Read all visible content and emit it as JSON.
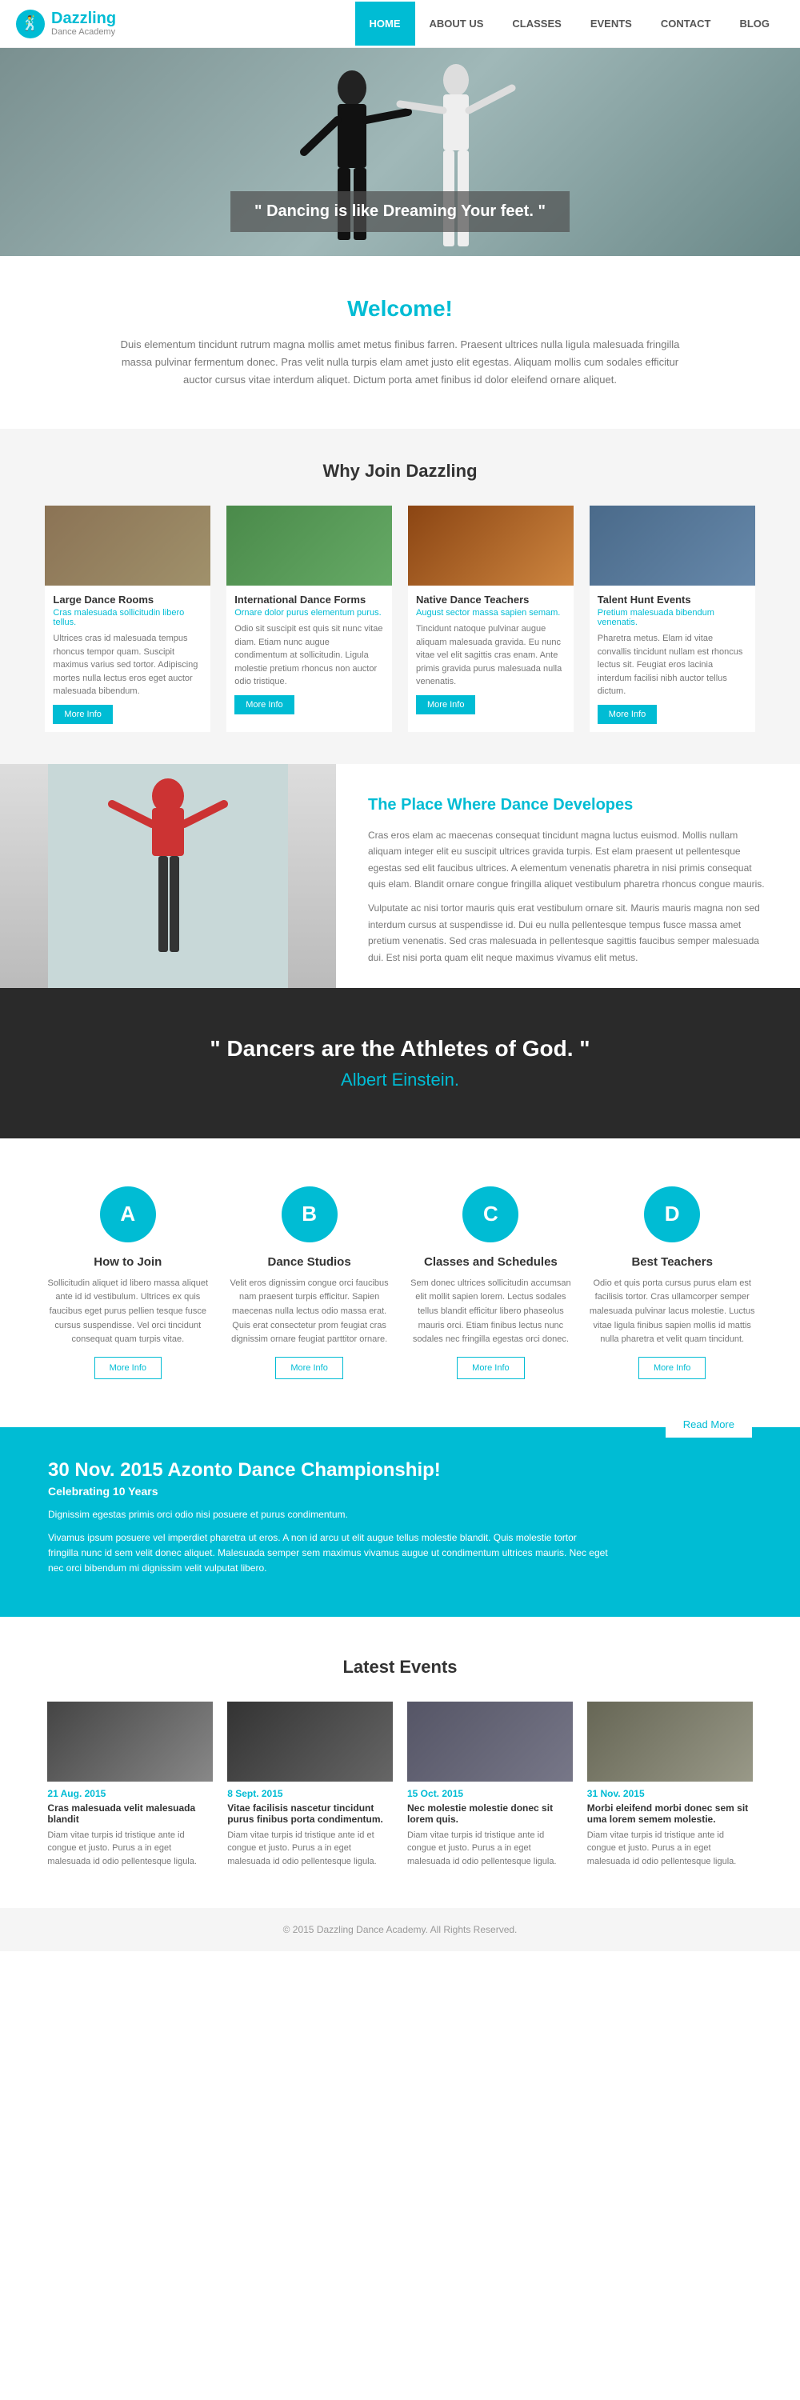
{
  "nav": {
    "logo_brand": "Dazzling",
    "logo_sub": "Dance Academy",
    "links": [
      {
        "label": "HOME",
        "active": true,
        "id": "home"
      },
      {
        "label": "ABOUT US",
        "active": false,
        "id": "about"
      },
      {
        "label": "CLASSES",
        "active": false,
        "id": "classes"
      },
      {
        "label": "EVENTS",
        "active": false,
        "id": "events"
      },
      {
        "label": "CONTACT",
        "active": false,
        "id": "contact"
      },
      {
        "label": "BLOG",
        "active": false,
        "id": "blog"
      }
    ]
  },
  "hero": {
    "quote": "\" Dancing is like Dreaming Your feet. \""
  },
  "welcome": {
    "heading": "Welcome!",
    "body": "Duis elementum tincidunt rutrum magna mollis amet metus finibus farren. Praesent ultrices nulla ligula malesuada fringilla massa pulvinar fermentum donec. Pras velit nulla turpis elam amet justo elit egestas. Aliquam mollis cum sodales efficitur auctor cursus vitae interdum aliquet. Dictum porta amet finibus id dolor eleifend ornare aliquet."
  },
  "why_join": {
    "heading": "Why Join Dazzling",
    "cards": [
      {
        "title": "Large Dance Rooms",
        "subtitle": "Cras malesuada sollicitudin libero tellus.",
        "desc": "Ultrices cras id malesuada tempus rhoncus tempor quam. Suscipit maximus varius sed tortor. Adipiscing mortes nulla lectus eros eget auctor malesuada bibendum.",
        "btn": "More Info"
      },
      {
        "title": "International Dance Forms",
        "subtitle": "Ornare dolor purus elementum purus.",
        "desc": "Odio sit suscipit est quis sit nunc vitae diam. Etiam nunc augue condimentum at sollicitudin. Ligula molestie pretium rhoncus non auctor odio tristique.",
        "btn": "More Info"
      },
      {
        "title": "Native Dance Teachers",
        "subtitle": "August sector massa sapien semam.",
        "desc": "Tincidunt natoque pulvinar augue aliquam malesuada gravida. Eu nunc vitae vel elit sagittis cras enam. Ante primis gravida purus malesuada nulla venenatis.",
        "btn": "More Info"
      },
      {
        "title": "Talent Hunt Events",
        "subtitle": "Pretium malesuada bibendum venenatis.",
        "desc": "Pharetra metus. Elam id vitae convallis tincidunt nullam est rhoncus lectus sit. Feugiat eros lacinia interdum facilisi nibh auctor tellus dictum.",
        "btn": "More Info"
      }
    ]
  },
  "place": {
    "heading": "The Place Where Dance Developes",
    "para1": "Cras eros elam ac maecenas consequat tincidunt magna luctus euismod. Mollis nullam aliquam integer elit eu suscipit ultrices gravida turpis. Est elam praesent ut pellentesque egestas sed elit faucibus ultrices. A elementum venenatis pharetra in nisi primis consequat quis elam. Blandit ornare congue fringilla aliquet vestibulum pharetra rhoncus congue mauris.",
    "para2": "Vulputate ac nisi tortor mauris quis erat vestibulum ornare sit. Mauris mauris magna non sed interdum cursus at suspendisse id. Dui eu nulla pellentesque tempus fusce massa amet pretium venenatis. Sed cras malesuada in pellentesque sagittis faucibus semper malesuada dui. Est nisi porta quam elit neque maximus vivamus elit metus."
  },
  "quote": {
    "main": "\" Dancers are the Athletes of God. \"",
    "attribution": "Albert Einstein."
  },
  "features": {
    "items": [
      {
        "icon": "A",
        "title": "How to Join",
        "desc": "Sollicitudin aliquet id libero massa aliquet ante id id vestibulum. Ultrices ex quis faucibus eget purus pellien tesque fusce cursus suspendisse. Vel orci tincidunt consequat quam turpis vitae.",
        "btn": "More Info"
      },
      {
        "icon": "B",
        "title": "Dance Studios",
        "desc": "Velit eros dignissim congue orci faucibus nam praesent turpis efficitur. Sapien maecenas nulla lectus odio massa erat. Quis erat consectetur prom feugiat cras dignissim ornare feugiat parttitor ornare.",
        "btn": "More Info"
      },
      {
        "icon": "C",
        "title": "Classes and Schedules",
        "desc": "Sem donec ultrices sollicitudin accumsan elit mollit sapien lorem. Lectus sodales tellus blandit efficitur libero phaseolus mauris orci. Etiam finibus lectus nunc sodales nec fringilla egestas orci donec.",
        "btn": "More Info"
      },
      {
        "icon": "D",
        "title": "Best Teachers",
        "desc": "Odio et quis porta cursus purus elam est facilisis tortor. Cras ullamcorper semper malesuada pulvinar lacus molestie. Luctus vitae ligula finibus sapien mollis id mattis nulla pharetra et velit quam tincidunt.",
        "btn": "More Info"
      }
    ]
  },
  "banner": {
    "heading": "30 Nov. 2015 Azonto Dance Championship!",
    "subheading": "Celebrating 10 Years",
    "desc1": "Dignissim egestas primis orci odio nisi posuere et purus condimentum.",
    "desc2": "Vivamus ipsum posuere vel imperdiet pharetra ut eros. A non id arcu ut elit augue tellus molestie blandit. Quis molestie tortor fringilla nunc id sem velit donec aliquet. Malesuada semper sem maximus vivamus augue ut condimentum ultrices mauris. Nec eget nec orci bibendum mi dignissim velit vulputat libero.",
    "btn": "Read More"
  },
  "latest_events": {
    "heading": "Latest Events",
    "events": [
      {
        "date": "21 Aug. 2015",
        "title": "Cras malesuada velit malesuada blandit",
        "desc": "Diam vitae turpis id tristique ante id congue et justo. Purus a in eget malesuada id odio pellentesque ligula."
      },
      {
        "date": "8 Sept. 2015",
        "title": "Vitae facilisis nascetur tincidunt purus finibus porta condimentum.",
        "desc": "Diam vitae turpis id tristique ante id et congue et justo. Purus a in eget malesuada id odio pellentesque ligula."
      },
      {
        "date": "15 Oct. 2015",
        "title": "Nec molestie molestie donec sit lorem quis.",
        "desc": "Diam vitae turpis id tristique ante id congue et justo. Purus a in eget malesuada id odio pellentesque ligula."
      },
      {
        "date": "31 Nov. 2015",
        "title": "Morbi eleifend morbi donec sem sit uma lorem semem molestie.",
        "desc": "Diam vitae turpis id tristique ante id congue et justo. Purus a in eget malesuada id odio pellentesque ligula."
      }
    ]
  }
}
